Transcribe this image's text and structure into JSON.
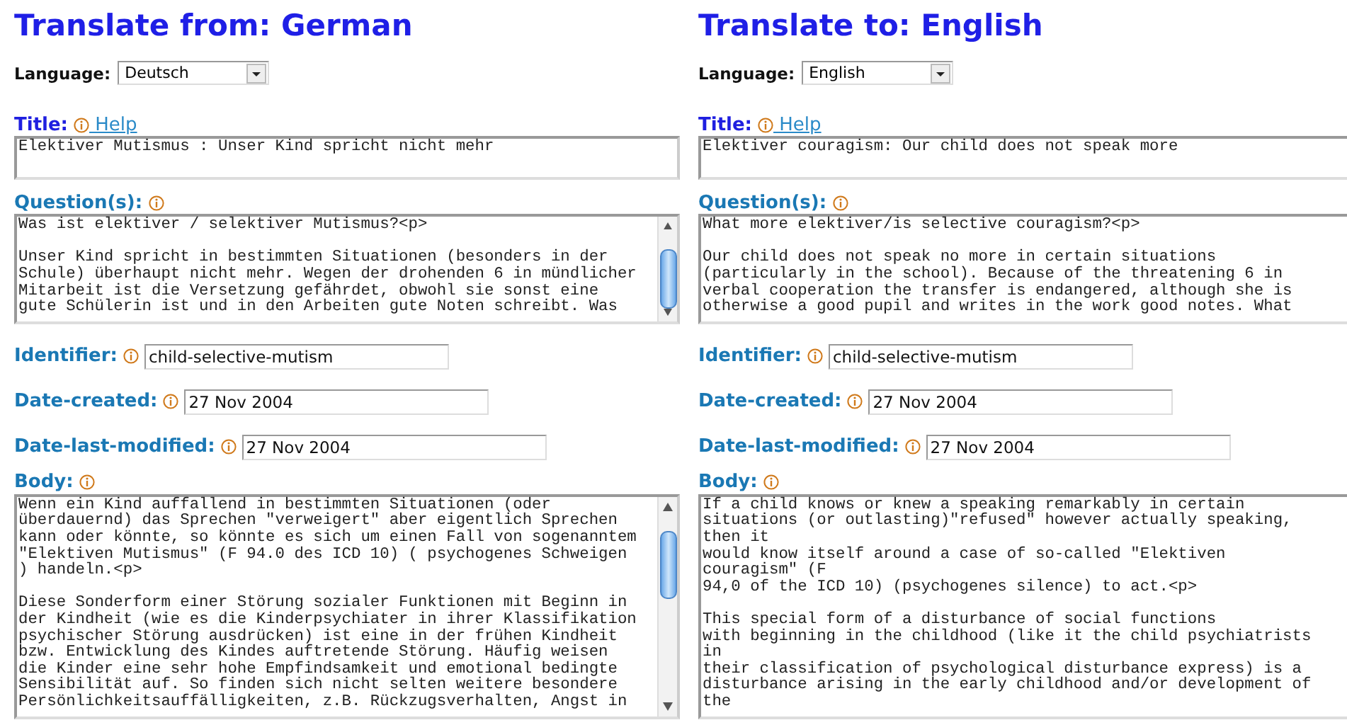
{
  "columns": [
    {
      "heading": "Translate from: German",
      "language": {
        "label": "Language:",
        "value": "Deutsch"
      },
      "fields": [
        {
          "kind": "textarea",
          "label": "Title:",
          "color": "#1f1fe0",
          "help": " Help",
          "text": "Elektiver Mutismus : Unser Kind spricht nicht mehr"
        },
        {
          "kind": "textarea",
          "label": "Question(s):",
          "color": "#1a78b4",
          "scrollbar": true,
          "text": "Was ist elektiver / selektiver Mutismus?<p>\n\nUnser Kind spricht in bestimmten Situationen (besonders in der\nSchule) überhaupt nicht mehr. Wegen der drohenden 6 in mündlicher\nMitarbeit ist die Versetzung gefährdet, obwohl sie sonst eine\ngute Schülerin ist und in den Arbeiten gute Noten schreibt. Was"
        },
        {
          "kind": "input",
          "label": "Identifier:",
          "color": "#1a78b4",
          "text": "child-selective-mutism"
        },
        {
          "kind": "input",
          "label": "Date-created:",
          "color": "#1a78b4",
          "text": "27 Nov 2004"
        },
        {
          "kind": "input",
          "label": "Date-last-modified:",
          "color": "#1a78b4",
          "text": "27 Nov 2004"
        },
        {
          "kind": "textarea",
          "label": "Body:",
          "color": "#1a78b4",
          "scrollbar": true,
          "text": "Wenn ein Kind auffallend in bestimmten Situationen (oder\nüberdauernd) das Sprechen \"verweigert\" aber eigentlich Sprechen\nkann oder könnte, so könnte es sich um einen Fall von sogenanntem\n\"Elektiven Mutismus\" (F 94.0 des ICD 10) ( psychogenes Schweigen\n) handeln.<p>\n\nDiese Sonderform einer Störung sozialer Funktionen mit Beginn in\nder Kindheit (wie es die Kinderpsychiater in ihrer Klassifikation\npsychischer Störung ausdrücken) ist eine in der frühen Kindheit\nbzw. Entwicklung des Kindes auftretende Störung. Häufig weisen\ndie Kinder eine sehr hohe Empfindsamkeit und emotional bedingte\nSensibilität auf. So finden sich nicht selten weitere besondere\nPersönlichkeitsauffälligkeiten, z.B. Rückzugsverhalten, Angst in"
        }
      ]
    },
    {
      "heading": "Translate to: English",
      "language": {
        "label": "Language:",
        "value": "English"
      },
      "fields": [
        {
          "kind": "textarea",
          "label": "Title:",
          "color": "#1f1fe0",
          "help": " Help",
          "text": "Elektiver couragism: Our child does not speak more"
        },
        {
          "kind": "textarea",
          "label": "Question(s):",
          "color": "#1a78b4",
          "text": "What more elektiver/is selective couragism?<p>\n\nOur child does not speak no more in certain situations\n(particularly in the school). Because of the threatening 6 in\nverbal cooperation the transfer is endangered, although she is\notherwise a good pupil and writes in the work good notes. What"
        },
        {
          "kind": "input",
          "label": "Identifier:",
          "color": "#1a78b4",
          "text": "child-selective-mutism"
        },
        {
          "kind": "input",
          "label": "Date-created:",
          "color": "#1a78b4",
          "text": "27 Nov 2004"
        },
        {
          "kind": "input",
          "label": "Date-last-modified:",
          "color": "#1a78b4",
          "text": "27 Nov 2004"
        },
        {
          "kind": "textarea",
          "label": "Body:",
          "color": "#1a78b4",
          "text": "If a child knows or knew a speaking remarkably in certain\nsituations (or outlasting)\"refused\" however actually speaking,\nthen it\nwould know itself around a case of so-called \"Elektiven\ncouragism\" (F\n94,0 of the ICD 10) (psychogenes silence) to act.<p>\n\nThis special form of a disturbance of social functions\nwith beginning in the childhood (like it the child psychiatrists\nin\ntheir classification of psychological disturbance express) is a\ndisturbance arising in the early childhood and/or development of\nthe"
        }
      ]
    }
  ]
}
